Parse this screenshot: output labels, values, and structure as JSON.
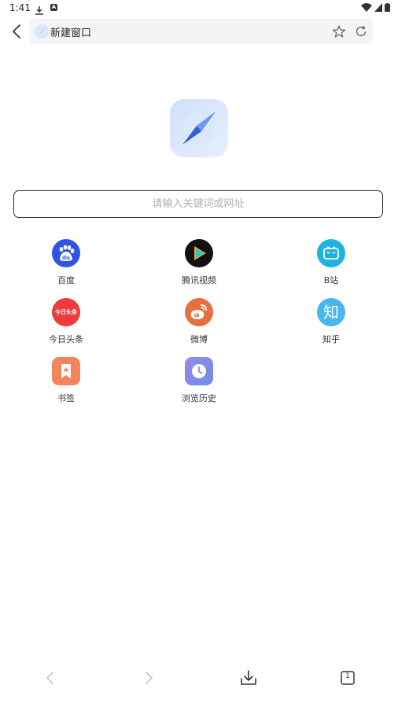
{
  "status_bar": {
    "time": "1:41"
  },
  "address_bar": {
    "title": "新建窗口"
  },
  "search": {
    "placeholder": "请输入关键词或网址"
  },
  "shortcuts": [
    {
      "label": "百度",
      "icon": "baidu-icon",
      "color": "#2f55e8"
    },
    {
      "label": "腾讯视频",
      "icon": "tencent-video-icon",
      "color": "#111111"
    },
    {
      "label": "B站",
      "icon": "bilibili-icon",
      "color": "#1db2e4"
    },
    {
      "label": "今日头条",
      "icon": "toutiao-icon",
      "color": "#ee3c3c",
      "icon_text": "今日头条"
    },
    {
      "label": "微博",
      "icon": "weibo-icon",
      "color": "#e6703f"
    },
    {
      "label": "知乎",
      "icon": "zhihu-icon",
      "color": "#47b7ee",
      "icon_text": "知"
    },
    {
      "label": "书签",
      "icon": "bookmark-icon",
      "color": "#f2865a"
    },
    {
      "label": "浏览历史",
      "icon": "history-icon",
      "color": "#7d88e6"
    }
  ],
  "toolbar": {
    "tab_count": "1"
  }
}
